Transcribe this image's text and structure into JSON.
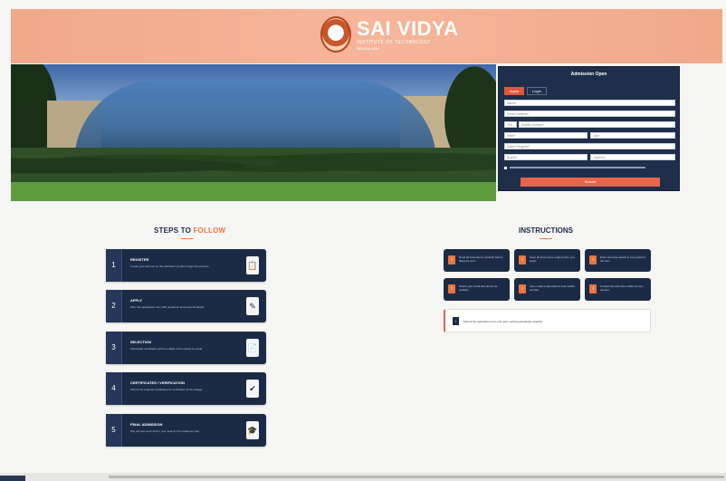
{
  "header": {
    "brand_name": "SAI VIDYA",
    "brand_sub": "INSTITUTE OF TECHNOLOGY",
    "brand_loc": "BENGALURU",
    "bg_color": "#f4ad90"
  },
  "admission": {
    "title": "Admission Open",
    "tabs": [
      "Apply",
      "Login"
    ],
    "fields": [
      {
        "placeholder": "Name*"
      },
      {
        "placeholder": "Email Address*"
      },
      {
        "placeholder": "+91"
      },
      {
        "placeholder": "Mobile Number*"
      },
      {
        "placeholder": "State*"
      },
      {
        "placeholder": "City*"
      },
      {
        "placeholder": "Select Program*"
      },
      {
        "placeholder": "Branch"
      },
      {
        "placeholder": "Captcha"
      }
    ],
    "submit_label": "Submit",
    "accent": "#e96448"
  },
  "steps": {
    "title_main": "STEPS TO ",
    "title_accent": "FOLLOW",
    "items": [
      {
        "num": "1",
        "name": "REGISTER",
        "desc": "Create your account on the admission portal to begin the process",
        "icon": "📋"
      },
      {
        "num": "2",
        "name": "APPLY",
        "desc": "Fill in the application form with academic and personal details",
        "icon": "✎"
      },
      {
        "num": "3",
        "name": "SELECTION",
        "desc": "Shortlisted candidates will be notified of the results by email",
        "icon": "📄"
      },
      {
        "num": "4",
        "name": "CERTIFICATES / VERIFICATION",
        "desc": "Submit the required certificates for verification at the college",
        "icon": "✔"
      },
      {
        "num": "5",
        "name": "FINAL ADMISSION",
        "desc": "Pay the fees and confirm your seat for the academic year",
        "icon": "🎓"
      }
    ]
  },
  "instructions": {
    "title": "INSTRUCTIONS",
    "items": [
      {
        "text": "Read all instructions carefully before filling the form"
      },
      {
        "text": "Keep all documents ready before you begin"
      },
      {
        "text": "Enter accurate details in every field of the form"
      },
      {
        "text": "Check your email and phone for updates"
      },
      {
        "text": "Use a valid email address and mobile number"
      },
      {
        "text": "Contact the admission office for any queries"
      }
    ],
    "note": "Submit the application form only after verifying all details carefully"
  }
}
